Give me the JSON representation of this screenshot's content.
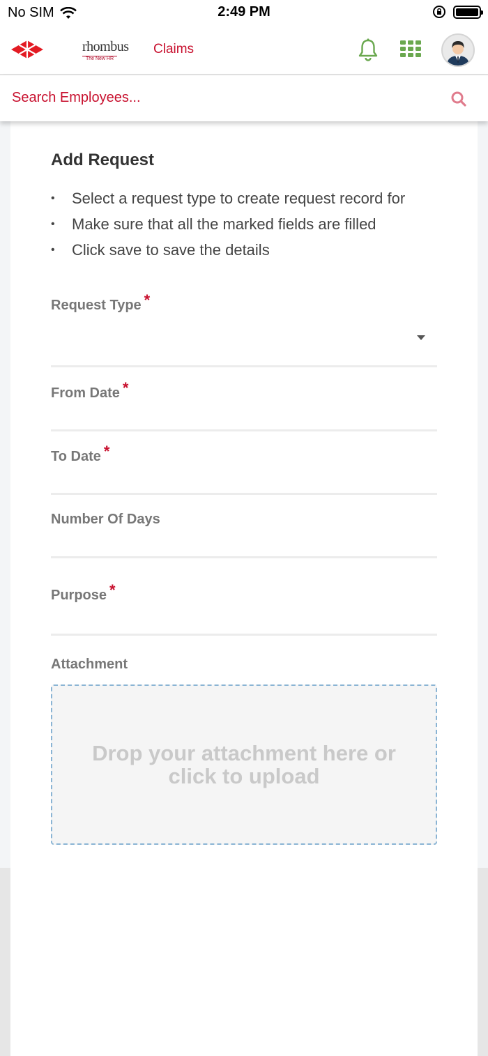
{
  "status_bar": {
    "carrier": "No SIM",
    "time": "2:49 PM"
  },
  "nav": {
    "brand": "rhombus",
    "brand_tagline": "The New HR",
    "active_module": "Claims"
  },
  "search": {
    "placeholder": "Search Employees..."
  },
  "form": {
    "title": "Add Request",
    "instructions": [
      "Select a request type to create request record for",
      "Make sure that all the marked fields are filled",
      "Click save to save the details"
    ],
    "required_mark": "*",
    "fields": {
      "request_type": "Request Type",
      "from_date": "From Date",
      "to_date": "To Date",
      "number_of_days": "Number Of Days",
      "purpose": "Purpose"
    },
    "attachment": {
      "label": "Attachment",
      "dropzone_text": "Drop your attachment here or click to upload"
    }
  },
  "colors": {
    "accent": "#c8102e",
    "icon_green": "#6aa84f",
    "dropzone_border": "#8ab4d4"
  }
}
